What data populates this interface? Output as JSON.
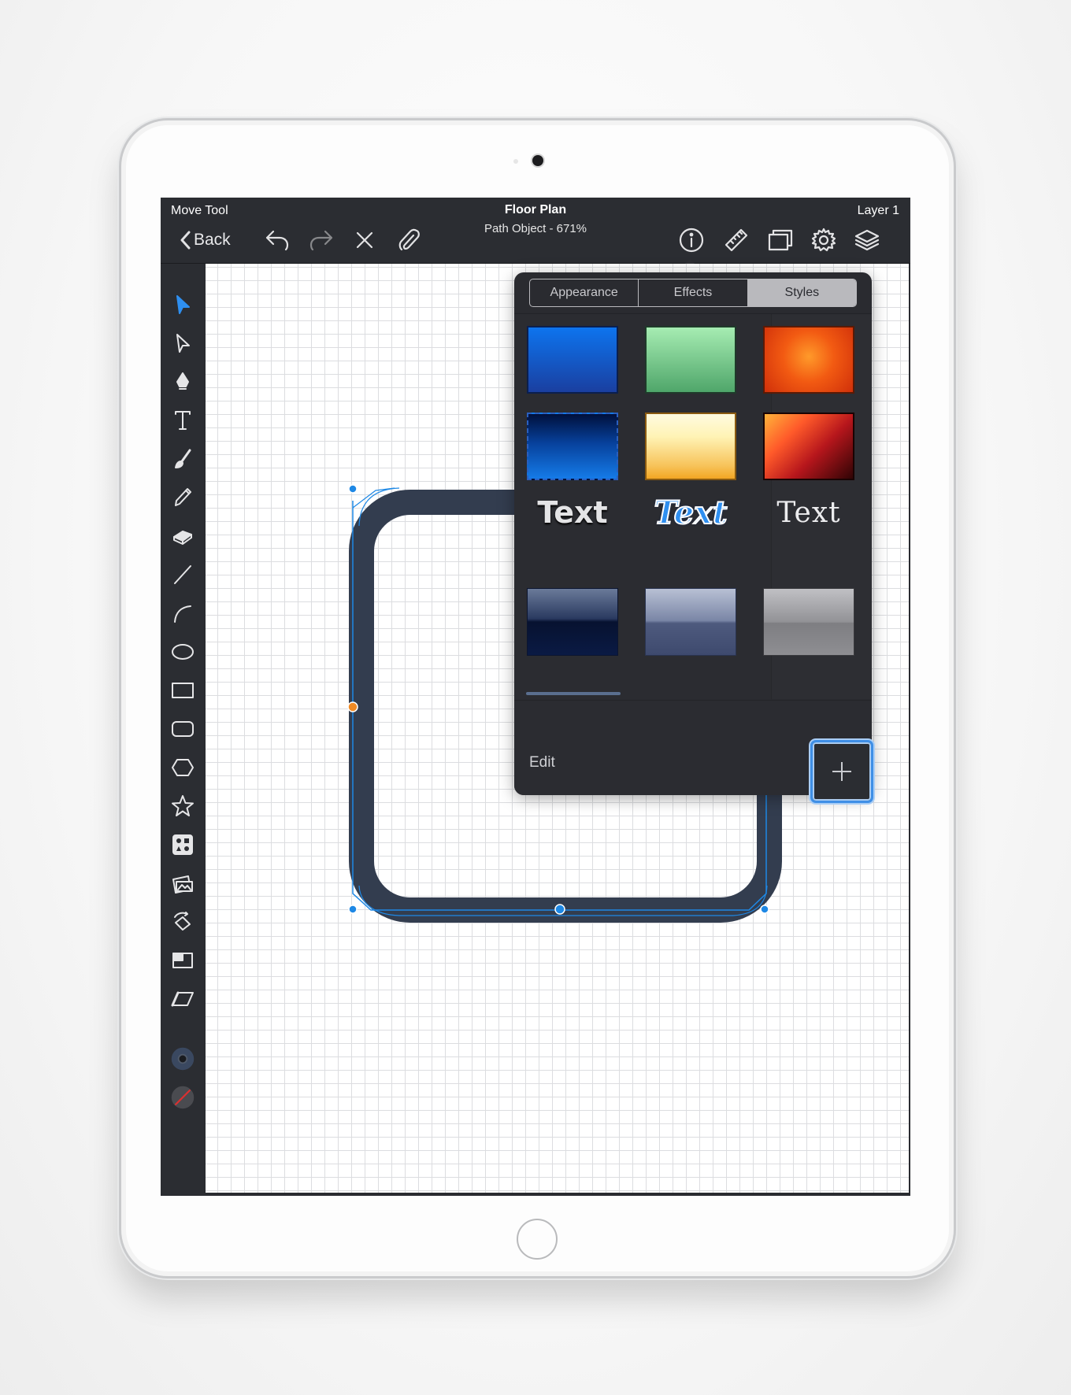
{
  "app": {
    "mode_title": "Move Tool",
    "document_title": "Floor Plan",
    "document_subtitle": "Path Object - 671%",
    "layer_title": "Layer 1",
    "back_label": "Back"
  },
  "toolbar_top": {
    "left_icons": [
      "undo-icon",
      "redo-icon",
      "close-icon",
      "paperclip-icon"
    ],
    "right_icons": [
      "info-icon",
      "ruler-icon",
      "artboard-icon",
      "gear-icon",
      "layers-icon"
    ]
  },
  "tools": [
    "select-arrow",
    "direct-select-arrow",
    "pen",
    "text",
    "brush",
    "pencil",
    "eraser",
    "line",
    "arc",
    "ellipse",
    "rectangle",
    "rounded-rectangle",
    "polygon",
    "star",
    "symbols",
    "image",
    "rotate",
    "scale",
    "shear",
    "stroke-color",
    "fill-color"
  ],
  "colors": {
    "accent": "#1e88e5",
    "selection_handle": "#1e88e5",
    "handle_orange": "#f08a24",
    "shape_stroke": "#333d4f"
  },
  "popover": {
    "tabs": [
      "Appearance",
      "Effects",
      "Styles"
    ],
    "active_tab": "Styles",
    "style_swatches": [
      "blue-gradient",
      "green-gradient",
      "orange-radial",
      "navy-dashed",
      "yellow-glow",
      "red-diagonal",
      "navy-gloss",
      "slate-gloss",
      "gray-gradient"
    ],
    "text_styles": [
      "Text",
      "Text",
      "Text"
    ],
    "edit_label": "Edit",
    "add_label": "+"
  }
}
